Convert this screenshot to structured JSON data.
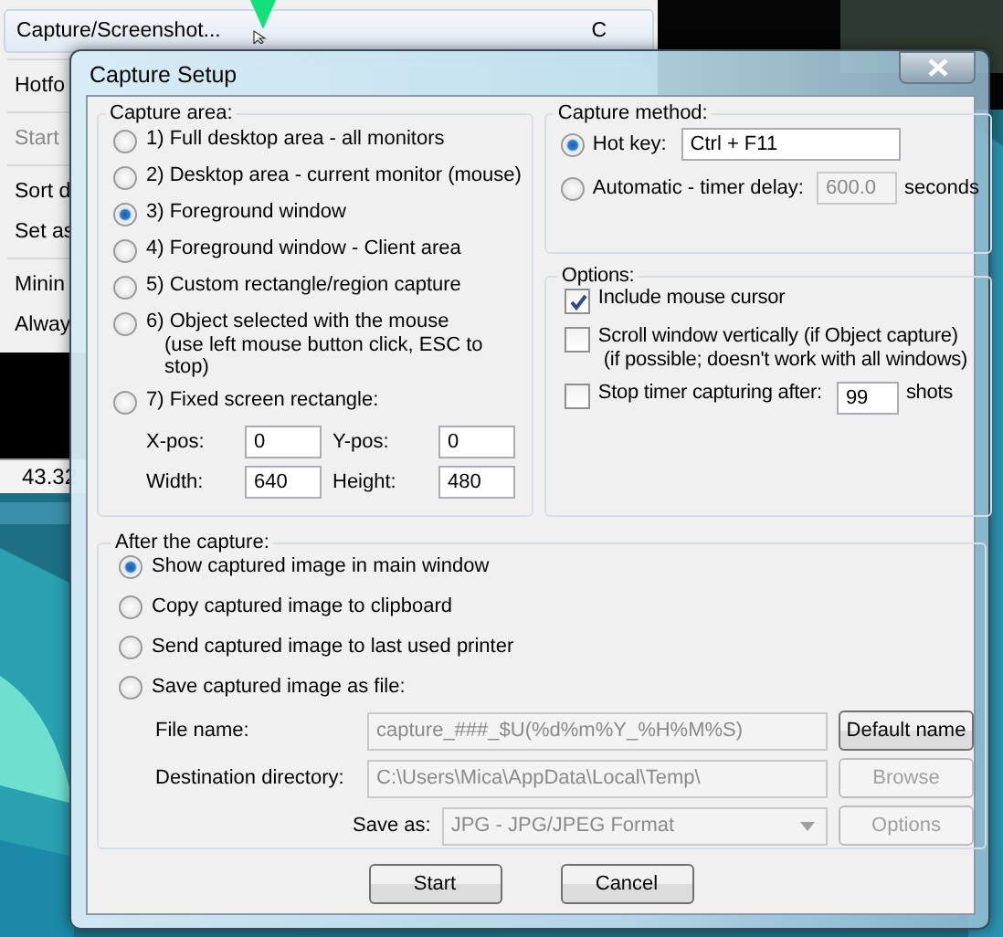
{
  "background_menu": {
    "items": [
      {
        "kind": "item",
        "label": "Capture/Screenshot...",
        "shortcut": "C",
        "disabled": false,
        "selected": true
      },
      {
        "kind": "separator"
      },
      {
        "kind": "item",
        "label": "Hotfo",
        "disabled": false,
        "selected": false
      },
      {
        "kind": "separator"
      },
      {
        "kind": "item",
        "label": "Start",
        "disabled": true,
        "selected": false
      },
      {
        "kind": "separator"
      },
      {
        "kind": "item",
        "label": "Sort d",
        "disabled": false,
        "selected": false
      },
      {
        "kind": "item",
        "label": "Set as",
        "disabled": false,
        "selected": false
      },
      {
        "kind": "separator"
      },
      {
        "kind": "item",
        "label": "Minin",
        "disabled": false,
        "selected": false
      },
      {
        "kind": "item",
        "label": "Alway",
        "disabled": false,
        "selected": false
      }
    ]
  },
  "background_status": "43.32",
  "dialog": {
    "title": "Capture Setup",
    "capture_area": {
      "heading": "Capture area:",
      "options": [
        {
          "label": "1) Full desktop area - all monitors",
          "selected": false
        },
        {
          "label": "2) Desktop area - current monitor (mouse)",
          "selected": false
        },
        {
          "label": "3) Foreground window",
          "selected": true
        },
        {
          "label": "4) Foreground window - Client area",
          "selected": false
        },
        {
          "label": "5) Custom rectangle/region capture",
          "selected": false
        },
        {
          "label": "6) Object selected with the mouse",
          "note": "(use left mouse button click, ESC to stop)",
          "selected": false
        },
        {
          "label": "7) Fixed screen rectangle:",
          "selected": false
        }
      ],
      "fields": [
        {
          "label": "X-pos:",
          "value": "0"
        },
        {
          "label": "Y-pos:",
          "value": "0"
        },
        {
          "label": "Width:",
          "value": "640"
        },
        {
          "label": "Height:",
          "value": "480"
        }
      ]
    },
    "capture_method": {
      "heading": "Capture method:",
      "options": [
        {
          "label": "Hot key:",
          "selected": true,
          "value": "Ctrl + F11",
          "disabled": false
        },
        {
          "label": "Automatic - timer delay:",
          "selected": false,
          "value": "600.0",
          "disabled": true,
          "unit": "seconds"
        }
      ]
    },
    "options": {
      "heading": "Options:",
      "items": [
        {
          "label": "Include mouse cursor",
          "checked": true
        },
        {
          "label": "Scroll window vertically (if Object capture)",
          "note": "(if possible; doesn't work with all windows)",
          "checked": false
        },
        {
          "label": "Stop timer capturing after:",
          "checked": false,
          "value": "99",
          "unit": "shots"
        }
      ]
    },
    "after_capture": {
      "heading": "After the capture:",
      "options": [
        {
          "label": "Show captured image in main window",
          "selected": true
        },
        {
          "label": "Copy captured image to clipboard",
          "selected": false
        },
        {
          "label": "Send captured image to last used printer",
          "selected": false
        },
        {
          "label": "Save captured image as file:",
          "selected": false
        }
      ],
      "file_name": {
        "label": "File name:",
        "value": "capture_###_$U(%d%m%Y_%H%M%S)",
        "disabled": true,
        "button": {
          "label": "Default name",
          "disabled": false
        }
      },
      "destination": {
        "label": "Destination directory:",
        "value": "C:\\Users\\Mica\\AppData\\Local\\Temp\\",
        "disabled": true,
        "button": {
          "label": "Browse",
          "disabled": true
        }
      },
      "save_as": {
        "label": "Save as:",
        "value": "JPG - JPG/JPEG Format",
        "disabled": true,
        "button": {
          "label": "Options",
          "disabled": true
        }
      }
    },
    "buttons": [
      {
        "label": "Start"
      },
      {
        "label": "Cancel"
      }
    ]
  }
}
